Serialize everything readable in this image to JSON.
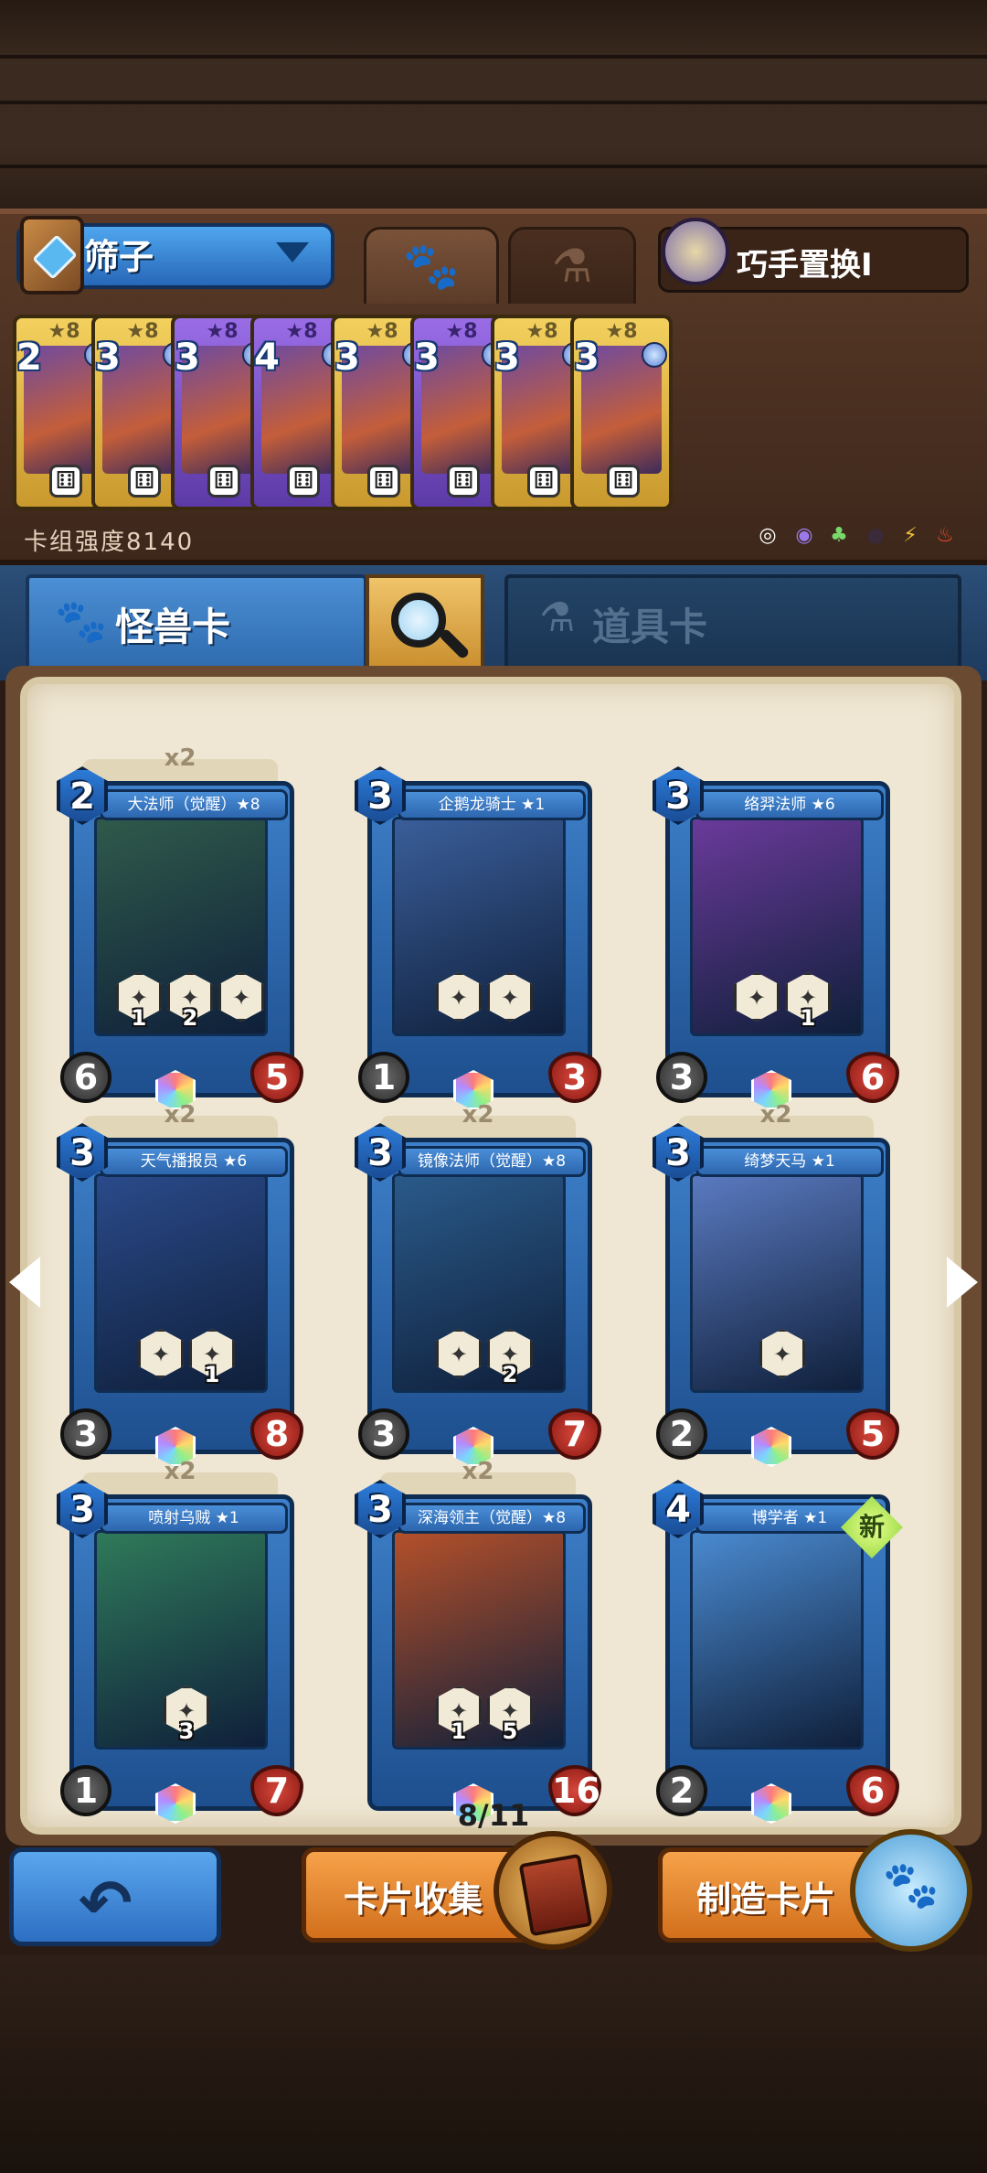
{
  "deck": {
    "name": "筛子",
    "skill_label": "巧手置换I",
    "strength_label": "卡组强度8140",
    "tabs": {
      "paw_icon": "paw-icon",
      "potion_icon": "potion-icon"
    },
    "cards": [
      {
        "cost": "2",
        "stars": "★8",
        "color": "gold"
      },
      {
        "cost": "3",
        "stars": "★8",
        "color": "gold"
      },
      {
        "cost": "3",
        "stars": "★8",
        "color": "purple"
      },
      {
        "cost": "4",
        "stars": "★8",
        "color": "purple"
      },
      {
        "cost": "3",
        "stars": "★8",
        "color": "gold"
      },
      {
        "cost": "3",
        "stars": "★8",
        "color": "purple"
      },
      {
        "cost": "3",
        "stars": "★8",
        "color": "gold"
      },
      {
        "cost": "3",
        "stars": "★8",
        "color": "gold"
      }
    ]
  },
  "tabs": {
    "monster": "怪兽卡",
    "item": "道具卡"
  },
  "cards": [
    {
      "name": "大法师（觉醒）★8",
      "mult": "x2",
      "cost": "2",
      "atk": "6",
      "hp": "5",
      "skills": [
        "1",
        "2",
        ""
      ],
      "art": "#2f5a4a"
    },
    {
      "name": "企鹅龙骑士 ★1",
      "mult": "",
      "cost": "3",
      "atk": "1",
      "hp": "3",
      "skills": [
        "",
        ""
      ],
      "art": "#3a5e9a"
    },
    {
      "name": "络羿法师 ★6",
      "mult": "",
      "cost": "3",
      "atk": "3",
      "hp": "6",
      "skills": [
        "",
        "1"
      ],
      "art": "#6a3a9a"
    },
    {
      "name": "天气播报员 ★6",
      "mult": "x2",
      "cost": "3",
      "atk": "3",
      "hp": "8",
      "skills": [
        "",
        "1"
      ],
      "art": "#2a4a8a"
    },
    {
      "name": "镜像法师（觉醒）★8",
      "mult": "x2",
      "cost": "3",
      "atk": "3",
      "hp": "7",
      "skills": [
        "",
        "2"
      ],
      "art": "#2a5a8a"
    },
    {
      "name": "绮梦天马 ★1",
      "mult": "x2",
      "cost": "3",
      "atk": "2",
      "hp": "5",
      "skills": [
        ""
      ],
      "art": "#5a7ac0"
    },
    {
      "name": "喷射乌贼 ★1",
      "mult": "x2",
      "cost": "3",
      "atk": "1",
      "hp": "7",
      "skills": [
        "3"
      ],
      "art": "#2f7a5a"
    },
    {
      "name": "深海领主（觉醒）★8",
      "mult": "x2",
      "cost": "3",
      "atk": "",
      "hp": "16",
      "skills": [
        "1",
        "5"
      ],
      "art": "#b4502a"
    },
    {
      "name": "博学者 ★1",
      "mult": "",
      "cost": "4",
      "atk": "2",
      "hp": "6",
      "skills": [],
      "art": "#4a8ad0",
      "new": "新"
    }
  ],
  "pagination": "8/11",
  "buttons": {
    "collect": "卡片收集",
    "craft": "制造卡片"
  }
}
